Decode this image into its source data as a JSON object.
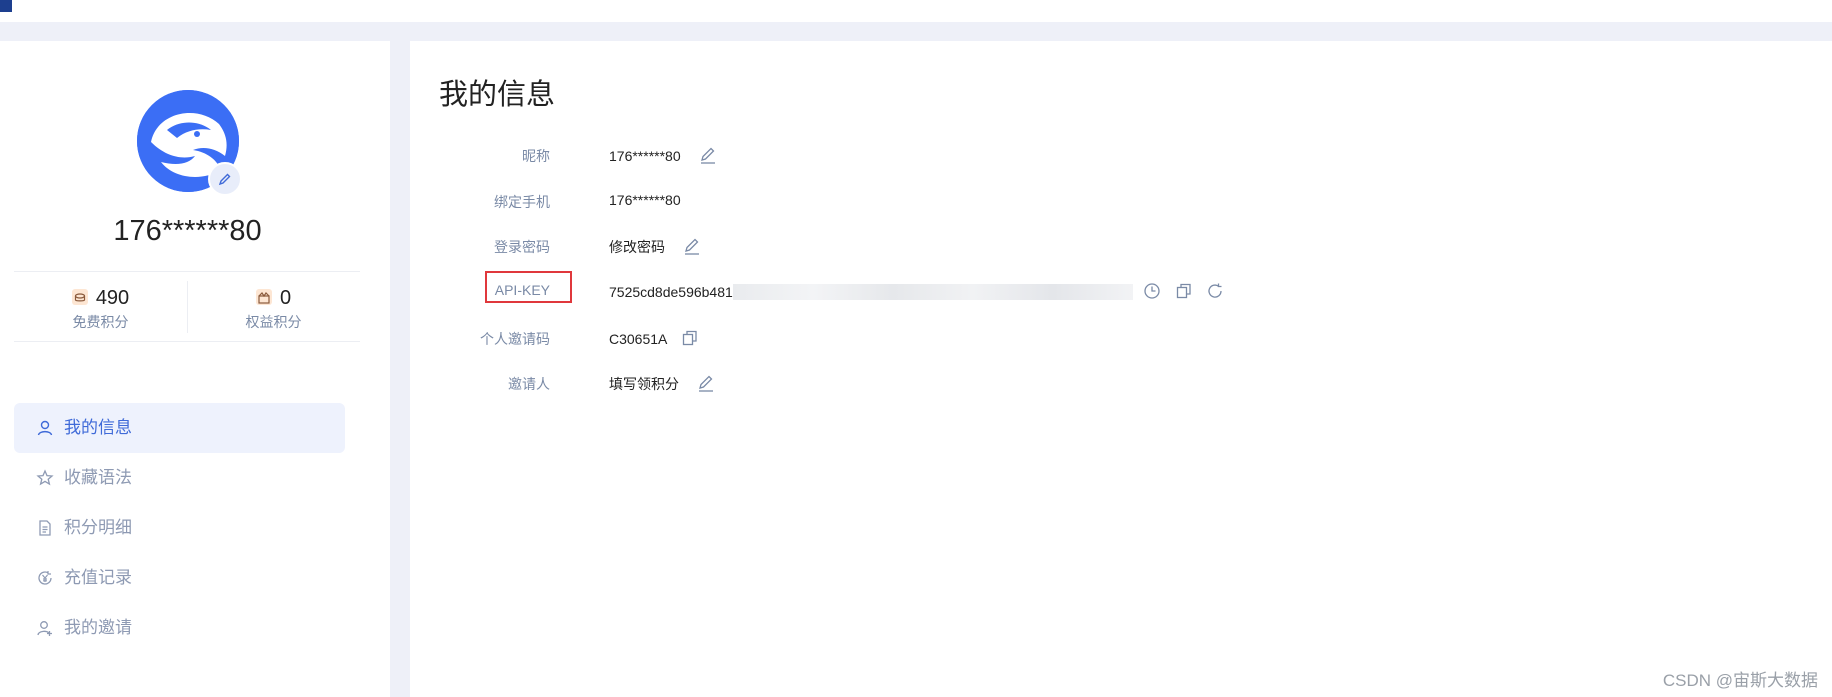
{
  "header": {
    "logo_text": ""
  },
  "profile": {
    "username": "176******80",
    "stats": [
      {
        "value": "490",
        "label": "免费积分",
        "icon": "coin-icon"
      },
      {
        "value": "0",
        "label": "权益积分",
        "icon": "gift-icon"
      }
    ]
  },
  "sidebar": {
    "items": [
      {
        "label": "我的信息",
        "icon": "user-icon",
        "active": true
      },
      {
        "label": "收藏语法",
        "icon": "star-icon",
        "active": false
      },
      {
        "label": "积分明细",
        "icon": "document-icon",
        "active": false
      },
      {
        "label": "充值记录",
        "icon": "yen-icon",
        "active": false
      },
      {
        "label": "我的邀请",
        "icon": "user-add-icon",
        "active": false
      }
    ]
  },
  "main": {
    "title": "我的信息",
    "fields": {
      "nickname": {
        "label": "昵称",
        "value": "176******80"
      },
      "phone": {
        "label": "绑定手机",
        "value": "176******80"
      },
      "password": {
        "label": "登录密码",
        "value": "修改密码"
      },
      "apikey": {
        "label": "API-KEY",
        "value": "7525cd8de596b481"
      },
      "invite_code": {
        "label": "个人邀请码",
        "value": "C30651A"
      },
      "inviter": {
        "label": "邀请人",
        "value": "填写领积分"
      }
    }
  },
  "watermark": "CSDN @宙斯大数据",
  "colors": {
    "accent": "#3f6ad8",
    "avatar": "#3b6ef5",
    "highlight_box": "#e0383c"
  }
}
